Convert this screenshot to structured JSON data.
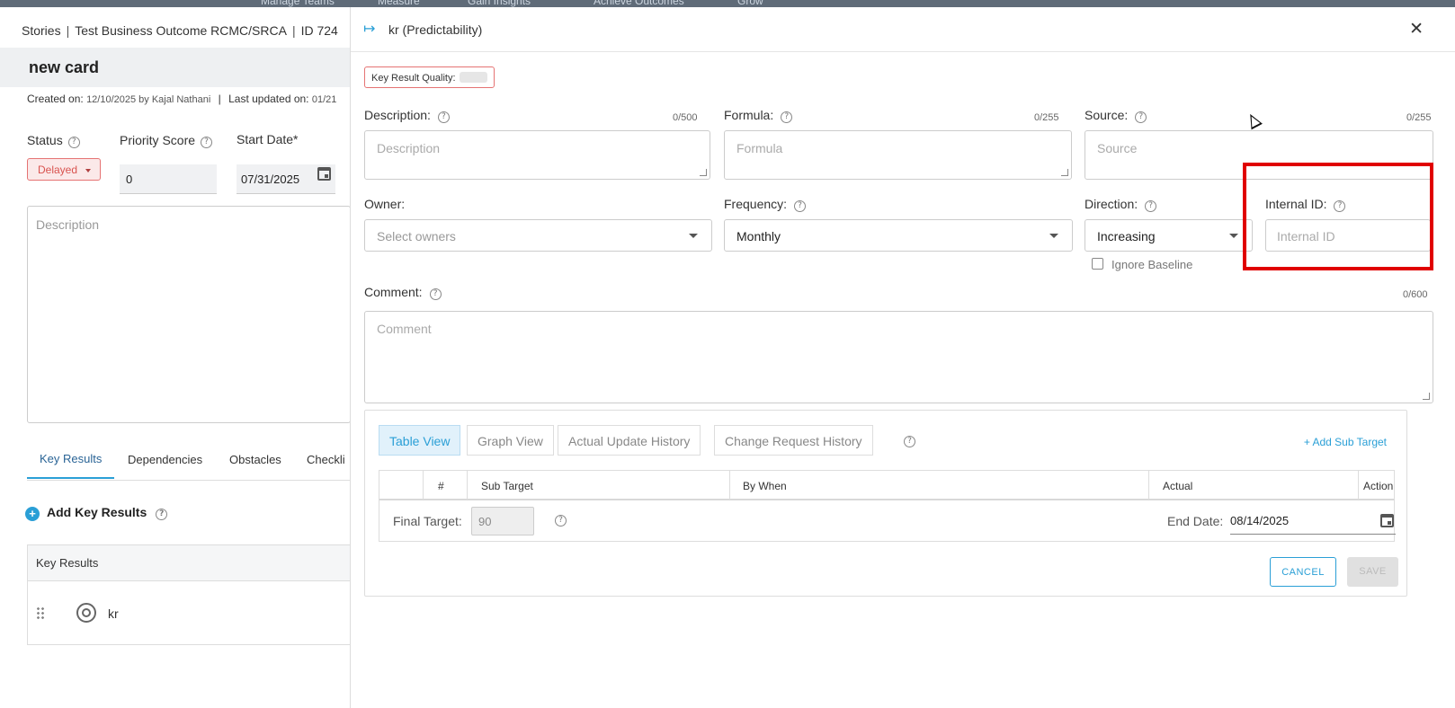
{
  "topbar": {
    "nav": [
      "Manage Teams",
      "Measure",
      "Gain Insights",
      "Achieve Outcomes",
      "Grow"
    ]
  },
  "left": {
    "breadcrumb": {
      "root": "Stories",
      "outcome": "Test Business Outcome RCMC/SRCA",
      "id": "ID 724"
    },
    "card_title": "new card",
    "meta": {
      "created_label": "Created on:",
      "created_value": "12/10/2025 by Kajal Nathani",
      "updated_label": "Last updated on:",
      "updated_value": "01/21"
    },
    "status_label": "Status",
    "status_value": "Delayed",
    "priority_label": "Priority Score",
    "priority_value": "0",
    "start_label": "Start Date*",
    "start_value": "07/31/2025",
    "description_placeholder": "Description",
    "tabs": [
      "Key Results",
      "Dependencies",
      "Obstacles",
      "Checkli"
    ],
    "add_kr_label": "Add Key Results",
    "kr_table_header": "Key Results",
    "kr_rows": [
      {
        "name": "kr"
      }
    ]
  },
  "drawer": {
    "title": "kr (Predictability)",
    "quality_label": "Key Result Quality:",
    "description": {
      "label": "Description:",
      "count": "0/500",
      "placeholder": "Description"
    },
    "formula": {
      "label": "Formula:",
      "count": "0/255",
      "placeholder": "Formula"
    },
    "source": {
      "label": "Source:",
      "count": "0/255",
      "placeholder": "Source"
    },
    "owner": {
      "label": "Owner:",
      "placeholder": "Select owners"
    },
    "frequency": {
      "label": "Frequency:",
      "value": "Monthly"
    },
    "direction": {
      "label": "Direction:",
      "value": "Increasing"
    },
    "ignore_baseline": "Ignore Baseline",
    "internal_id": {
      "label": "Internal ID:",
      "placeholder": "Internal ID"
    },
    "comment": {
      "label": "Comment:",
      "count": "0/600",
      "placeholder": "Comment"
    },
    "view_tabs": [
      "Table View",
      "Graph View",
      "Actual Update History",
      "Change Request History"
    ],
    "add_sub_target": "+ Add Sub Target",
    "columns": [
      "#",
      "Sub Target",
      "By When",
      "Actual",
      "Action"
    ],
    "final_target_label": "Final Target:",
    "final_target_value": "90",
    "end_date_label": "End Date:",
    "end_date_value": "08/14/2025",
    "cancel": "CANCEL",
    "save": "SAVE"
  }
}
